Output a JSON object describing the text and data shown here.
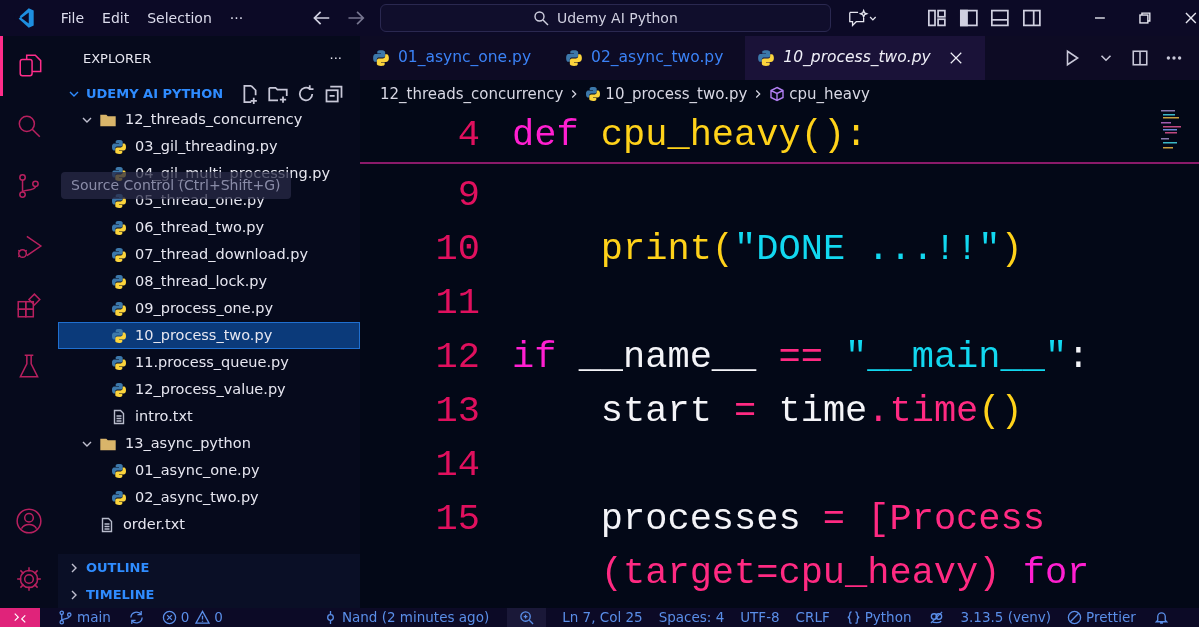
{
  "title_bar": {
    "menu": [
      "File",
      "Edit",
      "Selection",
      "···"
    ],
    "search": "Udemy AI Python"
  },
  "sidebar": {
    "title": "EXPLORER",
    "more": "···",
    "section": {
      "label": "UDEMY AI PYTHON",
      "expanded": true,
      "tree": [
        {
          "kind": "folder",
          "name": "12_threads_concurrency",
          "expanded": true,
          "children": [
            {
              "kind": "python",
              "name": "03_gil_threading.py",
              "selected": false
            },
            {
              "kind": "python",
              "name": "04_gil_multi_processing.py",
              "selected": false
            },
            {
              "kind": "python",
              "name": "05_thread_one.py",
              "selected": false
            },
            {
              "kind": "python",
              "name": "06_thread_two.py",
              "selected": false
            },
            {
              "kind": "python",
              "name": "07_thread_download.py",
              "selected": false
            },
            {
              "kind": "python",
              "name": "08_thread_lock.py",
              "selected": false
            },
            {
              "kind": "python",
              "name": "09_process_one.py",
              "selected": false
            },
            {
              "kind": "python",
              "name": "10_process_two.py",
              "selected": true
            },
            {
              "kind": "python",
              "name": "11.process_queue.py",
              "selected": false
            },
            {
              "kind": "python",
              "name": "12_process_value.py",
              "selected": false
            },
            {
              "kind": "text",
              "name": "intro.txt",
              "selected": false
            }
          ]
        },
        {
          "kind": "folder",
          "name": "13_async_python",
          "expanded": true,
          "children": [
            {
              "kind": "python",
              "name": "01_async_one.py",
              "selected": false
            },
            {
              "kind": "python",
              "name": "02_async_two.py",
              "selected": false
            }
          ]
        },
        {
          "kind": "text",
          "name": "order.txt",
          "selected": false
        }
      ]
    },
    "panels": [
      {
        "label": "OUTLINE",
        "expanded": false
      },
      {
        "label": "TIMELINE",
        "expanded": false
      }
    ],
    "tooltip": "Source Control (Ctrl+Shift+G)"
  },
  "tabs": [
    {
      "label": "01_async_one.py",
      "selected": false
    },
    {
      "label": "02_async_two.py",
      "selected": false
    },
    {
      "label": "10_process_two.py",
      "selected": true
    }
  ],
  "breadcrumbs": [
    "12_threads_concurrency",
    "10_process_two.py",
    "cpu_heavy"
  ],
  "editor": {
    "sticky": {
      "number": "4",
      "tokens": [
        {
          "text": "def",
          "kind": "kw"
        },
        {
          "text": " cpu_heavy",
          "kind": "fn"
        },
        {
          "text": "():",
          "kind": "fn"
        }
      ]
    },
    "lines": [
      {
        "number": "9"
      },
      {
        "number": "10",
        "tokens": [
          {
            "text": "    print",
            "kind": "fn"
          },
          {
            "text": "(",
            "kind": "fn"
          },
          {
            "text": "\"DONE ...!!\"",
            "kind": "str"
          },
          {
            "text": ")",
            "kind": "fn"
          }
        ]
      },
      {
        "number": "11"
      },
      {
        "number": "12",
        "tokens": [
          {
            "text": "if",
            "kind": "kw"
          },
          {
            "text": " __name__ ",
            "kind": "id"
          },
          {
            "text": "==",
            "kind": "op"
          },
          {
            "text": " \"__main__\"",
            "kind": "str"
          },
          {
            "text": ":",
            "kind": "id"
          }
        ]
      },
      {
        "number": "13",
        "tokens": [
          {
            "text": "    start ",
            "kind": "id"
          },
          {
            "text": "=",
            "kind": "op"
          },
          {
            "text": " time",
            "kind": "id"
          },
          {
            "text": ".time",
            "kind": "op"
          },
          {
            "text": "()",
            "kind": "fn"
          }
        ]
      },
      {
        "number": "14"
      },
      {
        "number": "15",
        "tokens": [
          {
            "text": "    processes ",
            "kind": "id"
          },
          {
            "text": "=",
            "kind": "op"
          },
          {
            "text": " [Process",
            "kind": "op"
          }
        ]
      },
      {
        "tokens": [
          {
            "text": "    (target=cpu_heavy)",
            "kind": "op"
          },
          {
            "text": " for",
            "kind": "kw"
          }
        ]
      }
    ]
  },
  "status_bar": [
    {
      "kind": "branch",
      "text": "main"
    },
    {
      "kind": "sync"
    },
    {
      "kind": "errors",
      "text": "0"
    },
    {
      "kind": "warnings",
      "text": "0"
    },
    {
      "kind": "commit",
      "text": "Nand (2 minutes ago)"
    },
    {
      "kind": "zoom"
    },
    {
      "kind": "plain",
      "text": "Ln 7, Col 25"
    },
    {
      "kind": "plain",
      "text": "Spaces: 4"
    },
    {
      "kind": "plain",
      "text": "UTF-8"
    },
    {
      "kind": "plain",
      "text": "CRLF"
    },
    {
      "kind": "language",
      "text": "Python"
    },
    {
      "kind": "copilot"
    },
    {
      "kind": "plain",
      "text": "3.13.5 (venv)"
    },
    {
      "kind": "prettier",
      "text": "Prettier"
    },
    {
      "kind": "bell"
    }
  ]
}
